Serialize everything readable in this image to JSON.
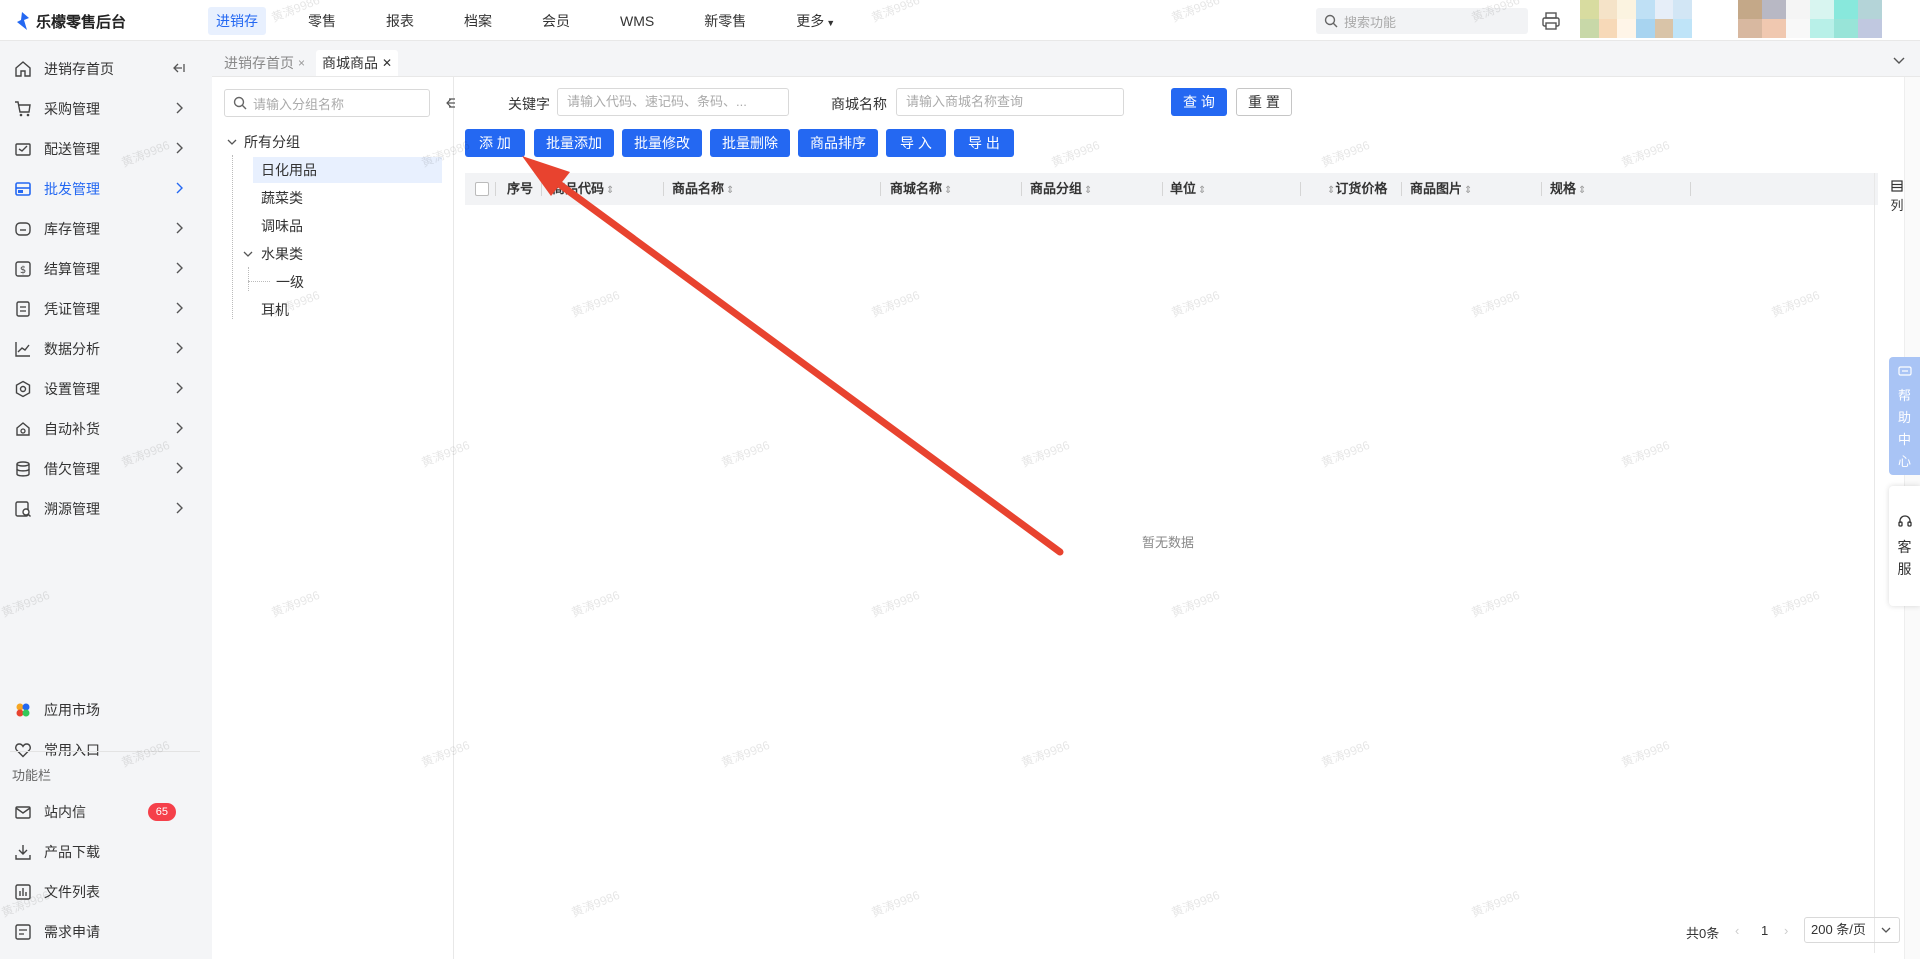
{
  "app": {
    "brand": "乐檬零售后台"
  },
  "topnav": [
    {
      "label": "进销存",
      "active": true
    },
    {
      "label": "零售"
    },
    {
      "label": "报表"
    },
    {
      "label": "档案"
    },
    {
      "label": "会员"
    },
    {
      "label": "WMS"
    },
    {
      "label": "新零售"
    },
    {
      "label": "更多"
    }
  ],
  "top_search": {
    "placeholder": "搜索功能"
  },
  "sidebar": {
    "items": [
      {
        "label": "进销存首页",
        "icon": "home-icon"
      },
      {
        "label": "采购管理",
        "icon": "cart-icon"
      },
      {
        "label": "配送管理",
        "icon": "delivery-icon"
      },
      {
        "label": "批发管理",
        "icon": "wholesale-icon",
        "active": true
      },
      {
        "label": "库存管理",
        "icon": "inventory-icon"
      },
      {
        "label": "结算管理",
        "icon": "settlement-icon"
      },
      {
        "label": "凭证管理",
        "icon": "voucher-icon"
      },
      {
        "label": "数据分析",
        "icon": "chart-icon"
      },
      {
        "label": "设置管理",
        "icon": "settings-icon"
      },
      {
        "label": "自动补货",
        "icon": "restock-icon"
      },
      {
        "label": "借欠管理",
        "icon": "debt-icon"
      },
      {
        "label": "溯源管理",
        "icon": "trace-icon"
      }
    ],
    "bottom_items": [
      {
        "label": "应用市场",
        "icon": "app-market-icon"
      },
      {
        "label": "常用入口",
        "icon": "heart-icon"
      }
    ],
    "section_title": "功能栏",
    "function_items": [
      {
        "label": "站内信",
        "icon": "mail-icon",
        "badge": "65"
      },
      {
        "label": "产品下载",
        "icon": "download-icon"
      },
      {
        "label": "文件列表",
        "icon": "file-list-icon"
      },
      {
        "label": "需求申请",
        "icon": "request-icon"
      }
    ]
  },
  "tabs": [
    {
      "label": "进销存首页",
      "close": "×"
    },
    {
      "label": "商城商品",
      "close": "✕",
      "active": true
    }
  ],
  "tree": {
    "search_placeholder": "请输入分组名称",
    "root": "所有分组",
    "nodes": [
      "日化用品",
      "蔬菜类",
      "调味品",
      "水果类",
      "一级",
      "耳机"
    ]
  },
  "filters": {
    "keyword_label": "关键字",
    "keyword_placeholder": "请输入代码、速记码、条码、...",
    "mall_name_label": "商城名称",
    "mall_name_placeholder": "请输入商城名称查询",
    "query": "查 询",
    "reset": "重 置"
  },
  "actions": [
    "添 加",
    "批量添加",
    "批量修改",
    "批量删除",
    "商品排序",
    "导 入",
    "导 出"
  ],
  "table": {
    "columns": [
      "序号",
      "商品代码",
      "商品名称",
      "商城名称",
      "商品分组",
      "单位",
      "订货价格",
      "商品图片",
      "规格"
    ],
    "empty": "暂无数据",
    "column_toggle": "列"
  },
  "pagination": {
    "total": "共0条",
    "page": "1",
    "page_size": "200 条/页"
  },
  "floating": {
    "help": [
      "帮",
      "助",
      "中",
      "心"
    ],
    "service": [
      "客",
      "服"
    ]
  },
  "watermark": "黄涛9986",
  "colors": {
    "primary": "#2468f2",
    "annotation_arrow": "#e8432f",
    "badge": "#f5404a"
  }
}
